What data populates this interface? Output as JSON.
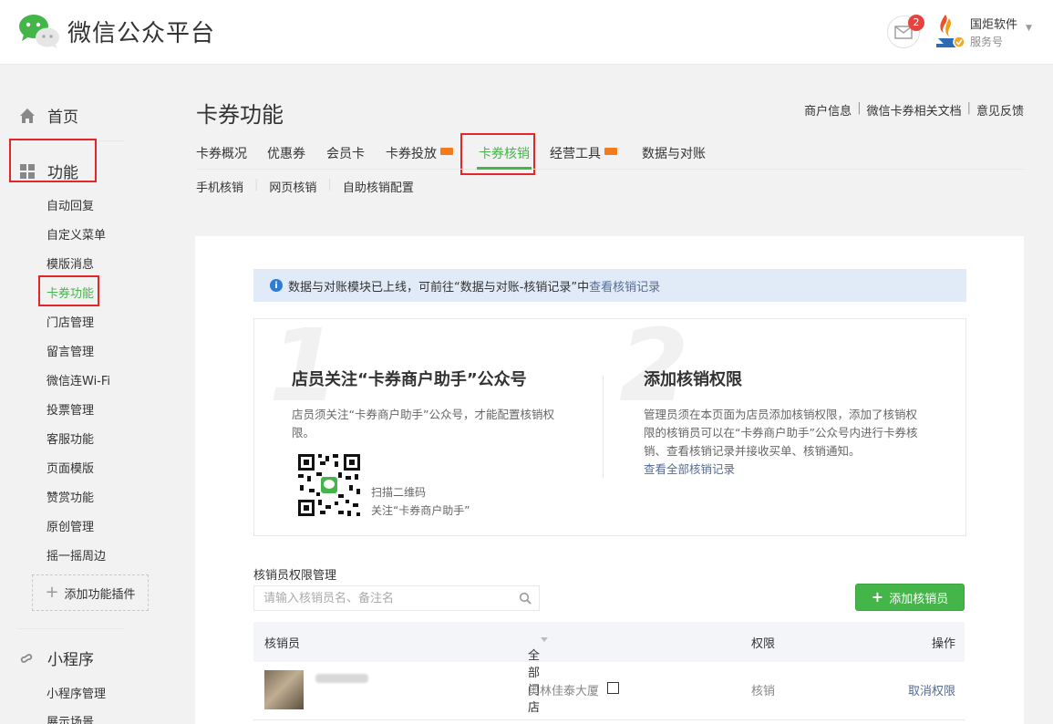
{
  "header": {
    "logo_text": "微信公众平台",
    "message_count": "2",
    "account_name": "国炬软件",
    "account_type": "服务号"
  },
  "sidebar": {
    "home": "首页",
    "function": "功能",
    "function_items": [
      "自动回复",
      "自定义菜单",
      "模版消息",
      "卡券功能",
      "门店管理",
      "留言管理",
      "微信连Wi-Fi",
      "投票管理",
      "客服功能",
      "页面模版",
      "赞赏功能",
      "原创管理",
      "摇一摇周边"
    ],
    "add_plugin": "添加功能插件",
    "miniprogram": "小程序",
    "mini_items": [
      "小程序管理",
      "展示场景"
    ]
  },
  "page": {
    "title": "卡券功能",
    "top_links": [
      "商户信息",
      "微信卡券相关文档",
      "意见反馈"
    ],
    "tabs": [
      "卡券概况",
      "优惠券",
      "会员卡",
      "卡券投放",
      "卡券核销",
      "经营工具",
      "数据与对账"
    ],
    "active_tab": "卡券核销",
    "subtabs": [
      "手机核销",
      "网页核销",
      "自助核销配置"
    ]
  },
  "notice": {
    "text": "数据与对账模块已上线，可前往“数据与对账-核销记录”中",
    "link": "查看核销记录"
  },
  "steps": [
    {
      "num": "1",
      "title": "店员关注“卡券商户助手”公众号",
      "desc": "店员须关注“卡券商户助手”公众号，才能配置核销权限。",
      "qr_caption1": "扫描二维码",
      "qr_caption2": "关注“卡券商户助手”"
    },
    {
      "num": "2",
      "title": "添加核销权限",
      "desc": "管理员须在本页面为店员添加核销权限，添加了核销权限的核销员可以在“卡券商户助手”公众号内进行卡券核销、查看核销记录并接收买单、核销通知。",
      "link": "查看全部核销记录"
    }
  ],
  "manager": {
    "label": "核销员权限管理",
    "search_placeholder": "请输入核销员名、备注名",
    "add_button": "添加核销员"
  },
  "table": {
    "headers": [
      "核销员",
      "全部门店",
      "权限",
      "操作"
    ],
    "rows": [
      {
        "store": "奥林佳泰大厦",
        "permission": "核销",
        "action": "取消权限"
      }
    ]
  },
  "colors": {
    "accent_green": "#44b549",
    "link_blue": "#576b95",
    "highlight_red": "#e2262a",
    "notice_bg": "#e1ebf7"
  }
}
